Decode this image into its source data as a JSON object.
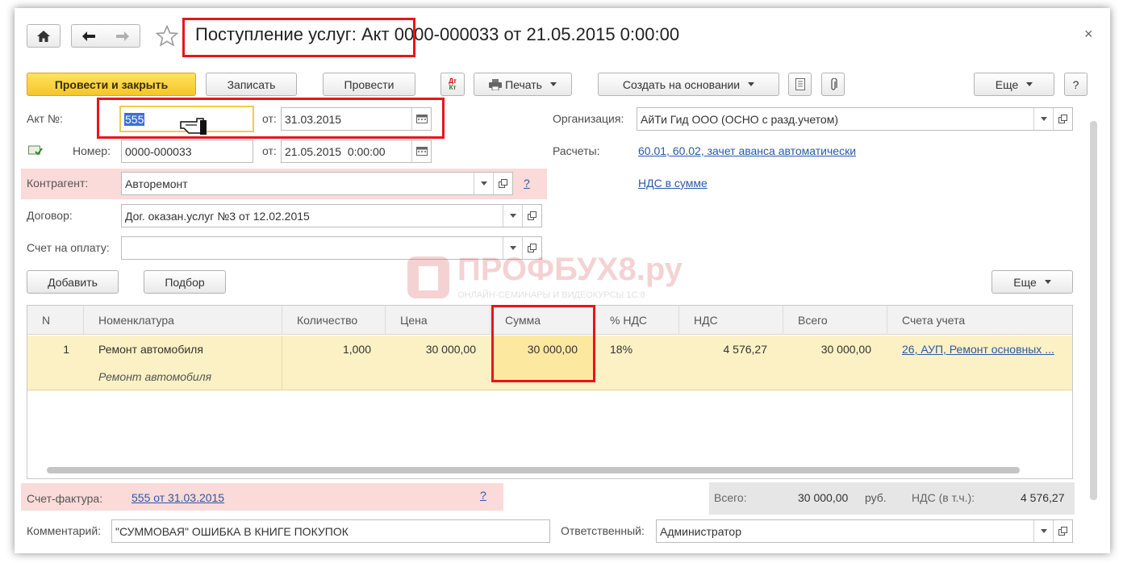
{
  "window": {
    "title": "Поступление услуг: Акт 0000-000033 от 21.05.2015 0:00:00",
    "close_glyph": "×"
  },
  "toolbar": {
    "post_close": "Провести и закрыть",
    "save": "Записать",
    "post": "Провести",
    "dt_kt_top": "Дт",
    "dt_kt_bottom": "Кт",
    "print": "Печать",
    "create_based": "Создать на основании",
    "more": "Еще",
    "help": "?"
  },
  "header": {
    "act_no_label": "Акт №:",
    "act_no_value": "555",
    "from1_label": "от:",
    "act_date": "31.03.2015",
    "number_label": "Номер:",
    "number_value": "0000-000033",
    "from2_label": "от:",
    "number_date": "21.05.2015  0:00:00",
    "counterparty_label": "Контрагент:",
    "counterparty_value": "Авторемонт",
    "counterparty_help": "?",
    "contract_label": "Договор:",
    "contract_value": "Дог. оказан.услуг №3 от 12.02.2015",
    "invoice_label": "Счет на оплату:",
    "invoice_value": "",
    "org_label": "Организация:",
    "org_value": "АйТи Гид ООО (ОСНО с разд.учетом)",
    "settlements_label": "Расчеты:",
    "settlements_link": "60.01, 60.02, зачет аванса автоматически",
    "vat_link": "НДС в сумме"
  },
  "table_toolbar": {
    "add": "Добавить",
    "pick": "Подбор",
    "more": "Еще"
  },
  "watermark": {
    "brand": "ПРОФБУХ8.ру",
    "tagline": "ОНЛАЙН-СЕМИНАРЫ И ВИДЕОКУРСЫ 1С:8"
  },
  "table": {
    "columns": [
      "N",
      "Номенклатура",
      "Количество",
      "Цена",
      "Сумма",
      "% НДС",
      "НДС",
      "Всего",
      "Счета учета"
    ],
    "rows": [
      {
        "n": "1",
        "item": "Ремонт автомобиля",
        "item_content": "Ремонт автомобиля",
        "qty": "1,000",
        "price": "30 000,00",
        "sum": "30 000,00",
        "vat_rate": "18%",
        "vat": "4 576,27",
        "total": "30 000,00",
        "accounts": "26, АУП, Ремонт основных ..."
      }
    ]
  },
  "footer": {
    "invoice_label": "Счет-фактура:",
    "invoice_link": "555 от 31.03.2015",
    "invoice_help": "?",
    "total_label": "Всего:",
    "total_value": "30 000,00",
    "currency": "руб.",
    "vat_label": "НДС (в т.ч.):",
    "vat_value": "4 576,27",
    "comment_label": "Комментарий:",
    "comment_value": "\"СУММОВАЯ\" ОШИБКА В КНИГЕ ПОКУПОК",
    "responsible_label": "Ответственный:",
    "responsible_value": "Администратор"
  },
  "colors": {
    "accent_yellow": "#f5c52b",
    "highlight_red": "#e8151b",
    "link_blue": "#2a59a6",
    "row_yellow": "#fbf1c4",
    "pink_required": "#fbdada"
  }
}
